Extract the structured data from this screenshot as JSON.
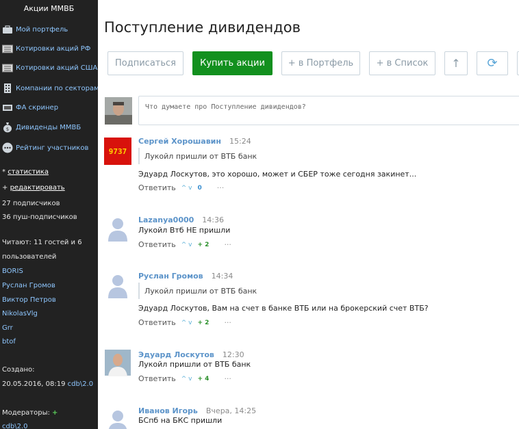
{
  "sidebar": {
    "title": "Акции ММВБ",
    "nav": [
      {
        "label": "Мой портфель",
        "icon": "briefcase-icon"
      },
      {
        "label": "Котировки акций РФ",
        "icon": "stock-ticker-icon"
      },
      {
        "label": "Котировки акций США",
        "icon": "stock-ticker-icon"
      },
      {
        "label": "Компании по секторам",
        "icon": "building-icon"
      },
      {
        "label": "ФА скринер",
        "icon": "screener-icon"
      },
      {
        "label": "Дивиденды ММВБ",
        "icon": "money-bag-icon"
      },
      {
        "label": "Рейтинг участников",
        "icon": "ellipsis-circle-icon"
      }
    ],
    "statistics_prefix": "*",
    "statistics_label": "статистика",
    "edit_prefix": "+",
    "edit_label": "редактировать",
    "subscribers": "27 подписчиков",
    "push_subscribers": "36 пуш-подписчиков",
    "reading_line1": "Читают: 11 гостей и 6",
    "reading_line2": "пользователей",
    "readers": [
      "BORIS",
      "Руслан Громов",
      "Виктор Петров",
      "NikolasVlg",
      "Grr",
      "btof"
    ],
    "created_label": "Создано:",
    "created_date": "20.05.2016, 08:19",
    "created_by": "cdb\\2.0",
    "moderators_label": "Модераторы:",
    "moderators_plus": "+",
    "moderator": "cdb\\2.0"
  },
  "main": {
    "title": "Поступление дивидендов",
    "buttons": {
      "subscribe": "Подписаться",
      "buy": "Купить акции",
      "portfolio": "+ в Портфель",
      "list": "+ в Список",
      "up": "↑",
      "refresh": "⟳"
    },
    "compose_placeholder": "Что думаете про Поступление дивидендов?",
    "reply_label": "Ответить",
    "more_label": "···",
    "vote_glyphs": "^ v",
    "comments": [
      {
        "author": "Сергей Хорошавин",
        "time": "15:24",
        "quote": "Лукойл пришли от ВТБ банк",
        "text": "Эдуард Лоскутов, это хорошо, может и СБЕР тоже сегодня закинет...",
        "score": "0",
        "avatar_text": "9737"
      },
      {
        "author": "Lazanya0000",
        "time": "14:36",
        "text": "Лукойл Втб НЕ пришли",
        "score": "+ 2"
      },
      {
        "author": "Руслан Громов",
        "time": "14:34",
        "quote": "Лукойл пришли от ВТБ банк",
        "text": "Эдуард Лоскутов, Вам на счет в банке ВТБ или на брокерский счет ВТБ?",
        "score": "+ 2"
      },
      {
        "author": "Эдуард Лоскутов",
        "time": "12:30",
        "text": "Лукойл пришли от ВТБ банк",
        "score": "+ 4"
      },
      {
        "author": "Иванов Игорь",
        "time": "Вчера, 14:25",
        "text": "БСпб на БКС пришли"
      }
    ]
  },
  "colors": {
    "sidebar_bg": "#222222",
    "link": "#8fc7ff",
    "author": "#5b93c9",
    "primary_button": "#12901e"
  }
}
